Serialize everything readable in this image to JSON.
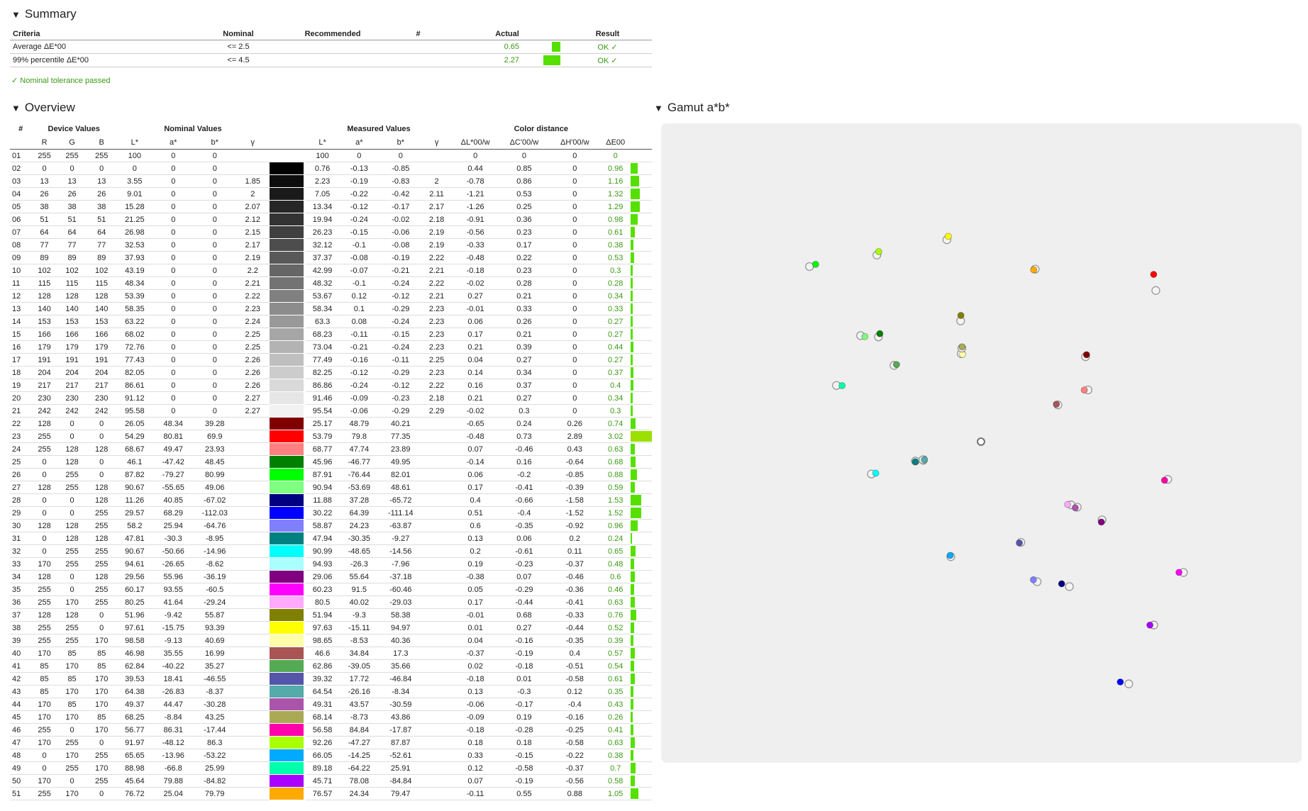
{
  "summary": {
    "title": "Summary",
    "headers": {
      "criteria": "Criteria",
      "nominal": "Nominal",
      "recommended": "Recommended",
      "num": "#",
      "actual": "Actual",
      "result": "Result"
    },
    "rows": [
      {
        "criteria": "Average ΔE*00",
        "nominal": "<= 2.5",
        "recommended": "",
        "num": "",
        "actual": "0.65",
        "bar_fraction": 0.26,
        "result": "OK ✓"
      },
      {
        "criteria": "99% percentile ΔE*00",
        "nominal": "<= 4.5",
        "recommended": "",
        "num": "",
        "actual": "2.27",
        "bar_fraction": 0.5,
        "result": "OK ✓"
      }
    ],
    "passed_text": "✓ Nominal tolerance passed"
  },
  "overview": {
    "title": "Overview",
    "group_headers": {
      "num": "#",
      "device": "Device Values",
      "nominal": "Nominal Values",
      "measured": "Measured Values",
      "distance": "Color distance"
    },
    "sub_headers": {
      "r": "R",
      "g": "G",
      "b": "B",
      "L": "L*",
      "a": "a*",
      "bb": "b*",
      "gamma": "γ",
      "dL": "ΔL*00/w",
      "dC": "ΔC'00/w",
      "dH": "ΔH'00/w",
      "dE": "ΔE00"
    },
    "rows": [
      {
        "id": "01",
        "r": 255,
        "g": 255,
        "b": 255,
        "nl": "100",
        "na": "0",
        "nb": "0",
        "ng": "",
        "ml": "100",
        "ma": "0",
        "mb": "0",
        "mg": "",
        "dl": "0",
        "dc": "0",
        "dh": "0",
        "de": "0"
      },
      {
        "id": "02",
        "r": 0,
        "g": 0,
        "b": 0,
        "nl": "0",
        "na": "0",
        "nb": "0",
        "ng": "",
        "ml": "0.76",
        "ma": "-0.13",
        "mb": "-0.85",
        "mg": "",
        "dl": "0.44",
        "dc": "0.85",
        "dh": "0",
        "de": "0.96"
      },
      {
        "id": "03",
        "r": 13,
        "g": 13,
        "b": 13,
        "nl": "3.55",
        "na": "0",
        "nb": "0",
        "ng": "1.85",
        "ml": "2.23",
        "ma": "-0.19",
        "mb": "-0.83",
        "mg": "2",
        "dl": "-0.78",
        "dc": "0.86",
        "dh": "0",
        "de": "1.16"
      },
      {
        "id": "04",
        "r": 26,
        "g": 26,
        "b": 26,
        "nl": "9.01",
        "na": "0",
        "nb": "0",
        "ng": "2",
        "ml": "7.05",
        "ma": "-0.22",
        "mb": "-0.42",
        "mg": "2.11",
        "dl": "-1.21",
        "dc": "0.53",
        "dh": "0",
        "de": "1.32"
      },
      {
        "id": "05",
        "r": 38,
        "g": 38,
        "b": 38,
        "nl": "15.28",
        "na": "0",
        "nb": "0",
        "ng": "2.07",
        "ml": "13.34",
        "ma": "-0.12",
        "mb": "-0.17",
        "mg": "2.17",
        "dl": "-1.26",
        "dc": "0.25",
        "dh": "0",
        "de": "1.29"
      },
      {
        "id": "06",
        "r": 51,
        "g": 51,
        "b": 51,
        "nl": "21.25",
        "na": "0",
        "nb": "0",
        "ng": "2.12",
        "ml": "19.94",
        "ma": "-0.24",
        "mb": "-0.02",
        "mg": "2.18",
        "dl": "-0.91",
        "dc": "0.36",
        "dh": "0",
        "de": "0.98"
      },
      {
        "id": "07",
        "r": 64,
        "g": 64,
        "b": 64,
        "nl": "26.98",
        "na": "0",
        "nb": "0",
        "ng": "2.15",
        "ml": "26.23",
        "ma": "-0.15",
        "mb": "-0.06",
        "mg": "2.19",
        "dl": "-0.56",
        "dc": "0.23",
        "dh": "0",
        "de": "0.61"
      },
      {
        "id": "08",
        "r": 77,
        "g": 77,
        "b": 77,
        "nl": "32.53",
        "na": "0",
        "nb": "0",
        "ng": "2.17",
        "ml": "32.12",
        "ma": "-0.1",
        "mb": "-0.08",
        "mg": "2.19",
        "dl": "-0.33",
        "dc": "0.17",
        "dh": "0",
        "de": "0.38"
      },
      {
        "id": "09",
        "r": 89,
        "g": 89,
        "b": 89,
        "nl": "37.93",
        "na": "0",
        "nb": "0",
        "ng": "2.19",
        "ml": "37.37",
        "ma": "-0.08",
        "mb": "-0.19",
        "mg": "2.22",
        "dl": "-0.48",
        "dc": "0.22",
        "dh": "0",
        "de": "0.53"
      },
      {
        "id": "10",
        "r": 102,
        "g": 102,
        "b": 102,
        "nl": "43.19",
        "na": "0",
        "nb": "0",
        "ng": "2.2",
        "ml": "42.99",
        "ma": "-0.07",
        "mb": "-0.21",
        "mg": "2.21",
        "dl": "-0.18",
        "dc": "0.23",
        "dh": "0",
        "de": "0.3"
      },
      {
        "id": "11",
        "r": 115,
        "g": 115,
        "b": 115,
        "nl": "48.34",
        "na": "0",
        "nb": "0",
        "ng": "2.21",
        "ml": "48.32",
        "ma": "-0.1",
        "mb": "-0.24",
        "mg": "2.22",
        "dl": "-0.02",
        "dc": "0.28",
        "dh": "0",
        "de": "0.28"
      },
      {
        "id": "12",
        "r": 128,
        "g": 128,
        "b": 128,
        "nl": "53.39",
        "na": "0",
        "nb": "0",
        "ng": "2.22",
        "ml": "53.67",
        "ma": "0.12",
        "mb": "-0.12",
        "mg": "2.21",
        "dl": "0.27",
        "dc": "0.21",
        "dh": "0",
        "de": "0.34"
      },
      {
        "id": "13",
        "r": 140,
        "g": 140,
        "b": 140,
        "nl": "58.35",
        "na": "0",
        "nb": "0",
        "ng": "2.23",
        "ml": "58.34",
        "ma": "0.1",
        "mb": "-0.29",
        "mg": "2.23",
        "dl": "-0.01",
        "dc": "0.33",
        "dh": "0",
        "de": "0.33"
      },
      {
        "id": "14",
        "r": 153,
        "g": 153,
        "b": 153,
        "nl": "63.22",
        "na": "0",
        "nb": "0",
        "ng": "2.24",
        "ml": "63.3",
        "ma": "0.08",
        "mb": "-0.24",
        "mg": "2.23",
        "dl": "0.06",
        "dc": "0.26",
        "dh": "0",
        "de": "0.27"
      },
      {
        "id": "15",
        "r": 166,
        "g": 166,
        "b": 166,
        "nl": "68.02",
        "na": "0",
        "nb": "0",
        "ng": "2.25",
        "ml": "68.23",
        "ma": "-0.11",
        "mb": "-0.15",
        "mg": "2.23",
        "dl": "0.17",
        "dc": "0.21",
        "dh": "0",
        "de": "0.27"
      },
      {
        "id": "16",
        "r": 179,
        "g": 179,
        "b": 179,
        "nl": "72.76",
        "na": "0",
        "nb": "0",
        "ng": "2.25",
        "ml": "73.04",
        "ma": "-0.21",
        "mb": "-0.24",
        "mg": "2.23",
        "dl": "0.21",
        "dc": "0.39",
        "dh": "0",
        "de": "0.44"
      },
      {
        "id": "17",
        "r": 191,
        "g": 191,
        "b": 191,
        "nl": "77.43",
        "na": "0",
        "nb": "0",
        "ng": "2.26",
        "ml": "77.49",
        "ma": "-0.16",
        "mb": "-0.11",
        "mg": "2.25",
        "dl": "0.04",
        "dc": "0.27",
        "dh": "0",
        "de": "0.27"
      },
      {
        "id": "18",
        "r": 204,
        "g": 204,
        "b": 204,
        "nl": "82.05",
        "na": "0",
        "nb": "0",
        "ng": "2.26",
        "ml": "82.25",
        "ma": "-0.12",
        "mb": "-0.29",
        "mg": "2.23",
        "dl": "0.14",
        "dc": "0.34",
        "dh": "0",
        "de": "0.37"
      },
      {
        "id": "19",
        "r": 217,
        "g": 217,
        "b": 217,
        "nl": "86.61",
        "na": "0",
        "nb": "0",
        "ng": "2.26",
        "ml": "86.86",
        "ma": "-0.24",
        "mb": "-0.12",
        "mg": "2.22",
        "dl": "0.16",
        "dc": "0.37",
        "dh": "0",
        "de": "0.4"
      },
      {
        "id": "20",
        "r": 230,
        "g": 230,
        "b": 230,
        "nl": "91.12",
        "na": "0",
        "nb": "0",
        "ng": "2.27",
        "ml": "91.46",
        "ma": "-0.09",
        "mb": "-0.23",
        "mg": "2.18",
        "dl": "0.21",
        "dc": "0.27",
        "dh": "0",
        "de": "0.34"
      },
      {
        "id": "21",
        "r": 242,
        "g": 242,
        "b": 242,
        "nl": "95.58",
        "na": "0",
        "nb": "0",
        "ng": "2.27",
        "ml": "95.54",
        "ma": "-0.06",
        "mb": "-0.29",
        "mg": "2.29",
        "dl": "-0.02",
        "dc": "0.3",
        "dh": "0",
        "de": "0.3"
      },
      {
        "id": "22",
        "r": 128,
        "g": 0,
        "b": 0,
        "nl": "26.05",
        "na": "48.34",
        "nb": "39.28",
        "ng": "",
        "ml": "25.17",
        "ma": "48.79",
        "mb": "40.21",
        "mg": "",
        "dl": "-0.65",
        "dc": "0.24",
        "dh": "0.26",
        "de": "0.74"
      },
      {
        "id": "23",
        "r": 255,
        "g": 0,
        "b": 0,
        "nl": "54.29",
        "na": "80.81",
        "nb": "69.9",
        "ng": "",
        "ml": "53.79",
        "ma": "79.8",
        "mb": "77.35",
        "mg": "",
        "dl": "-0.48",
        "dc": "0.73",
        "dh": "2.89",
        "de": "3.02"
      },
      {
        "id": "24",
        "r": 255,
        "g": 128,
        "b": 128,
        "nl": "68.67",
        "na": "49.47",
        "nb": "23.93",
        "ng": "",
        "ml": "68.77",
        "ma": "47.74",
        "mb": "23.89",
        "mg": "",
        "dl": "0.07",
        "dc": "-0.46",
        "dh": "0.43",
        "de": "0.63"
      },
      {
        "id": "25",
        "r": 0,
        "g": 128,
        "b": 0,
        "nl": "46.1",
        "na": "-47.42",
        "nb": "48.45",
        "ng": "",
        "ml": "45.96",
        "ma": "-46.77",
        "mb": "49.95",
        "mg": "",
        "dl": "-0.14",
        "dc": "0.16",
        "dh": "-0.64",
        "de": "0.68"
      },
      {
        "id": "26",
        "r": 0,
        "g": 255,
        "b": 0,
        "nl": "87.82",
        "na": "-79.27",
        "nb": "80.99",
        "ng": "",
        "ml": "87.91",
        "ma": "-76.44",
        "mb": "82.01",
        "mg": "",
        "dl": "0.06",
        "dc": "-0.2",
        "dh": "-0.85",
        "de": "0.88"
      },
      {
        "id": "27",
        "r": 128,
        "g": 255,
        "b": 128,
        "nl": "90.67",
        "na": "-55.65",
        "nb": "49.06",
        "ng": "",
        "ml": "90.94",
        "ma": "-53.69",
        "mb": "48.61",
        "mg": "",
        "dl": "0.17",
        "dc": "-0.41",
        "dh": "-0.39",
        "de": "0.59"
      },
      {
        "id": "28",
        "r": 0,
        "g": 0,
        "b": 128,
        "nl": "11.26",
        "na": "40.85",
        "nb": "-67.02",
        "ng": "",
        "ml": "11.88",
        "ma": "37.28",
        "mb": "-65.72",
        "mg": "",
        "dl": "0.4",
        "dc": "-0.66",
        "dh": "-1.58",
        "de": "1.53"
      },
      {
        "id": "29",
        "r": 0,
        "g": 0,
        "b": 255,
        "nl": "29.57",
        "na": "68.29",
        "nb": "-112.03",
        "ng": "",
        "ml": "30.22",
        "ma": "64.39",
        "mb": "-111.14",
        "mg": "",
        "dl": "0.51",
        "dc": "-0.4",
        "dh": "-1.52",
        "de": "1.52"
      },
      {
        "id": "30",
        "r": 128,
        "g": 128,
        "b": 255,
        "nl": "58.2",
        "na": "25.94",
        "nb": "-64.76",
        "ng": "",
        "ml": "58.87",
        "ma": "24.23",
        "mb": "-63.87",
        "mg": "",
        "dl": "0.6",
        "dc": "-0.35",
        "dh": "-0.92",
        "de": "0.96"
      },
      {
        "id": "31",
        "r": 0,
        "g": 128,
        "b": 128,
        "nl": "47.81",
        "na": "-30.3",
        "nb": "-8.95",
        "ng": "",
        "ml": "47.94",
        "ma": "-30.35",
        "mb": "-9.27",
        "mg": "",
        "dl": "0.13",
        "dc": "0.06",
        "dh": "0.2",
        "de": "0.24"
      },
      {
        "id": "32",
        "r": 0,
        "g": 255,
        "b": 255,
        "nl": "90.67",
        "na": "-50.66",
        "nb": "-14.96",
        "ng": "",
        "ml": "90.99",
        "ma": "-48.65",
        "mb": "-14.56",
        "mg": "",
        "dl": "0.2",
        "dc": "-0.61",
        "dh": "0.11",
        "de": "0.65"
      },
      {
        "id": "33",
        "r": 170,
        "g": 255,
        "b": 255,
        "nl": "94.61",
        "na": "-26.65",
        "nb": "-8.62",
        "ng": "",
        "ml": "94.93",
        "ma": "-26.3",
        "mb": "-7.96",
        "mg": "",
        "dl": "0.19",
        "dc": "-0.23",
        "dh": "-0.37",
        "de": "0.48"
      },
      {
        "id": "34",
        "r": 128,
        "g": 0,
        "b": 128,
        "nl": "29.56",
        "na": "55.96",
        "nb": "-36.19",
        "ng": "",
        "ml": "29.06",
        "ma": "55.64",
        "mb": "-37.18",
        "mg": "",
        "dl": "-0.38",
        "dc": "0.07",
        "dh": "-0.46",
        "de": "0.6"
      },
      {
        "id": "35",
        "r": 255,
        "g": 0,
        "b": 255,
        "nl": "60.17",
        "na": "93.55",
        "nb": "-60.5",
        "ng": "",
        "ml": "60.23",
        "ma": "91.5",
        "mb": "-60.46",
        "mg": "",
        "dl": "0.05",
        "dc": "-0.29",
        "dh": "-0.36",
        "de": "0.46"
      },
      {
        "id": "36",
        "r": 255,
        "g": 170,
        "b": 255,
        "nl": "80.25",
        "na": "41.64",
        "nb": "-29.24",
        "ng": "",
        "ml": "80.5",
        "ma": "40.02",
        "mb": "-29.03",
        "mg": "",
        "dl": "0.17",
        "dc": "-0.44",
        "dh": "-0.41",
        "de": "0.63"
      },
      {
        "id": "37",
        "r": 128,
        "g": 128,
        "b": 0,
        "nl": "51.96",
        "na": "-9.42",
        "nb": "55.87",
        "ng": "",
        "ml": "51.94",
        "ma": "-9.3",
        "mb": "58.38",
        "mg": "",
        "dl": "-0.01",
        "dc": "0.68",
        "dh": "-0.33",
        "de": "0.76"
      },
      {
        "id": "38",
        "r": 255,
        "g": 255,
        "b": 0,
        "nl": "97.61",
        "na": "-15.75",
        "nb": "93.39",
        "ng": "",
        "ml": "97.63",
        "ma": "-15.11",
        "mb": "94.97",
        "mg": "",
        "dl": "0.01",
        "dc": "0.27",
        "dh": "-0.44",
        "de": "0.52"
      },
      {
        "id": "39",
        "r": 255,
        "g": 255,
        "b": 170,
        "nl": "98.58",
        "na": "-9.13",
        "nb": "40.69",
        "ng": "",
        "ml": "98.65",
        "ma": "-8.53",
        "mb": "40.36",
        "mg": "",
        "dl": "0.04",
        "dc": "-0.16",
        "dh": "-0.35",
        "de": "0.39"
      },
      {
        "id": "40",
        "r": 170,
        "g": 85,
        "b": 85,
        "nl": "46.98",
        "na": "35.55",
        "nb": "16.99",
        "ng": "",
        "ml": "46.6",
        "ma": "34.84",
        "mb": "17.3",
        "mg": "",
        "dl": "-0.37",
        "dc": "-0.19",
        "dh": "0.4",
        "de": "0.57"
      },
      {
        "id": "41",
        "r": 85,
        "g": 170,
        "b": 85,
        "nl": "62.84",
        "na": "-40.22",
        "nb": "35.27",
        "ng": "",
        "ml": "62.86",
        "ma": "-39.05",
        "mb": "35.66",
        "mg": "",
        "dl": "0.02",
        "dc": "-0.18",
        "dh": "-0.51",
        "de": "0.54"
      },
      {
        "id": "42",
        "r": 85,
        "g": 85,
        "b": 170,
        "nl": "39.53",
        "na": "18.41",
        "nb": "-46.55",
        "ng": "",
        "ml": "39.32",
        "ma": "17.72",
        "mb": "-46.84",
        "mg": "",
        "dl": "-0.18",
        "dc": "0.01",
        "dh": "-0.58",
        "de": "0.61"
      },
      {
        "id": "43",
        "r": 85,
        "g": 170,
        "b": 170,
        "nl": "64.38",
        "na": "-26.83",
        "nb": "-8.37",
        "ng": "",
        "ml": "64.54",
        "ma": "-26.16",
        "mb": "-8.34",
        "mg": "",
        "dl": "0.13",
        "dc": "-0.3",
        "dh": "0.12",
        "de": "0.35"
      },
      {
        "id": "44",
        "r": 170,
        "g": 85,
        "b": 170,
        "nl": "49.37",
        "na": "44.47",
        "nb": "-30.28",
        "ng": "",
        "ml": "49.31",
        "ma": "43.57",
        "mb": "-30.59",
        "mg": "",
        "dl": "-0.06",
        "dc": "-0.17",
        "dh": "-0.4",
        "de": "0.43"
      },
      {
        "id": "45",
        "r": 170,
        "g": 170,
        "b": 85,
        "nl": "68.25",
        "na": "-8.84",
        "nb": "43.25",
        "ng": "",
        "ml": "68.14",
        "ma": "-8.73",
        "mb": "43.86",
        "mg": "",
        "dl": "-0.09",
        "dc": "0.19",
        "dh": "-0.16",
        "de": "0.26"
      },
      {
        "id": "46",
        "r": 255,
        "g": 0,
        "b": 170,
        "nl": "56.77",
        "na": "86.31",
        "nb": "-17.44",
        "ng": "",
        "ml": "56.58",
        "ma": "84.84",
        "mb": "-17.87",
        "mg": "",
        "dl": "-0.18",
        "dc": "-0.28",
        "dh": "-0.25",
        "de": "0.41"
      },
      {
        "id": "47",
        "r": 170,
        "g": 255,
        "b": 0,
        "nl": "91.97",
        "na": "-48.12",
        "nb": "86.3",
        "ng": "",
        "ml": "92.26",
        "ma": "-47.27",
        "mb": "87.87",
        "mg": "",
        "dl": "0.18",
        "dc": "0.18",
        "dh": "-0.58",
        "de": "0.63"
      },
      {
        "id": "48",
        "r": 0,
        "g": 170,
        "b": 255,
        "nl": "65.65",
        "na": "-13.96",
        "nb": "-53.22",
        "ng": "",
        "ml": "66.05",
        "ma": "-14.25",
        "mb": "-52.61",
        "mg": "",
        "dl": "0.33",
        "dc": "-0.15",
        "dh": "-0.22",
        "de": "0.38"
      },
      {
        "id": "49",
        "r": 0,
        "g": 255,
        "b": 170,
        "nl": "88.98",
        "na": "-66.8",
        "nb": "25.99",
        "ng": "",
        "ml": "89.18",
        "ma": "-64.22",
        "mb": "25.91",
        "mg": "",
        "dl": "0.12",
        "dc": "-0.58",
        "dh": "-0.37",
        "de": "0.7"
      },
      {
        "id": "50",
        "r": 170,
        "g": 0,
        "b": 255,
        "nl": "45.64",
        "na": "79.88",
        "nb": "-84.82",
        "ng": "",
        "ml": "45.71",
        "ma": "78.08",
        "mb": "-84.84",
        "mg": "",
        "dl": "0.07",
        "dc": "-0.19",
        "dh": "-0.56",
        "de": "0.58"
      },
      {
        "id": "51",
        "r": 255,
        "g": 170,
        "b": 0,
        "nl": "76.72",
        "na": "25.04",
        "nb": "79.79",
        "ng": "",
        "ml": "76.57",
        "ma": "24.34",
        "mb": "79.47",
        "mg": "",
        "dl": "-0.11",
        "dc": "0.55",
        "dh": "0.88",
        "de": "1.05"
      }
    ]
  },
  "gamut": {
    "title": "Gamut a*b*"
  },
  "chart_data": {
    "type": "scatter",
    "title": "Gamut a*b*",
    "xlim": [
      -130,
      130
    ],
    "ylim": [
      -130,
      130
    ],
    "grid": false,
    "note": "points are nominal (grey ring) vs measured (filled) a*/b* per patch, taken from overview.rows"
  },
  "colors": {
    "ok": "#3a9a13",
    "bar_green": "#55e000",
    "bar_yellow": "#9be000",
    "panel_bg": "#efefef"
  }
}
